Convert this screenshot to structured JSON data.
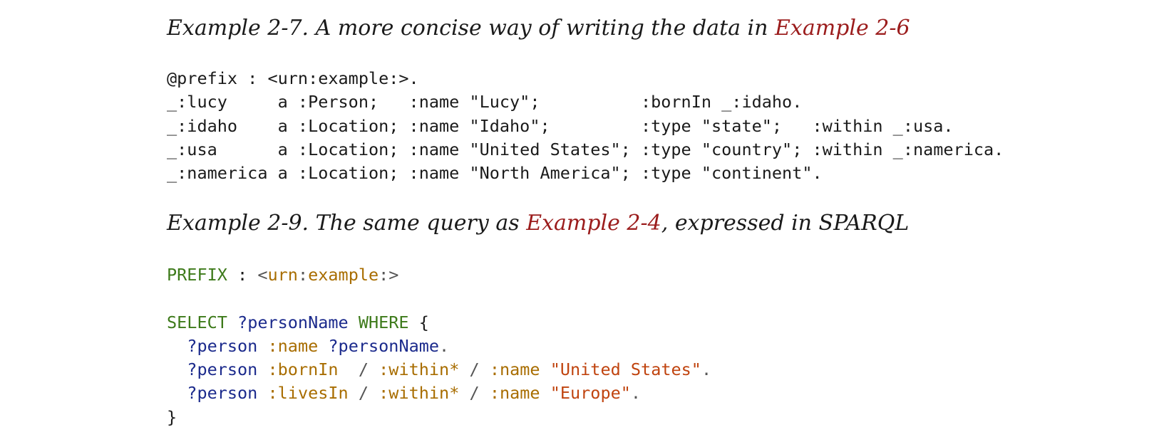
{
  "example_2_7": {
    "caption_text": "Example 2-7. A more concise way of writing the data in ",
    "caption_link": "Example 2-6",
    "code_lines": [
      "@prefix : <urn:example:>.",
      "_:lucy     a :Person;   :name \"Lucy\";          :bornIn _:idaho.",
      "_:idaho    a :Location; :name \"Idaho\";         :type \"state\";   :within _:usa.",
      "_:usa      a :Location; :name \"United States\"; :type \"country\"; :within _:namerica.",
      "_:namerica a :Location; :name \"North America\"; :type \"continent\"."
    ]
  },
  "example_2_9": {
    "caption_prefix": "Example 2-9. The same query as ",
    "caption_link": "Example 2-4",
    "caption_suffix": ", expressed in SPARQL",
    "code": {
      "prefix_kw": "PREFIX",
      "prefix_colon": " : ",
      "prefix_open": "<",
      "prefix_urn": "urn",
      "prefix_sep": ":",
      "prefix_example": "example",
      "prefix_close": ":>",
      "select_kw": "SELECT",
      "select_var": "?personName",
      "where_kw": "WHERE",
      "open_brace": "{",
      "l1_var": "?person",
      "l1_pred": ":name",
      "l1_obj": "?personName",
      "l1_end": ".",
      "l2_var": "?person",
      "l2_pred1": ":bornIn",
      "l2_slash1": "/",
      "l2_pred2": ":within*",
      "l2_slash2": "/",
      "l2_pred3": ":name",
      "l2_str": "\"United States\"",
      "l2_end": ".",
      "l3_var": "?person",
      "l3_pred1": ":livesIn",
      "l3_slash1": "/",
      "l3_pred2": ":within*",
      "l3_slash2": "/",
      "l3_pred3": ":name",
      "l3_str": "\"Europe\"",
      "l3_end": ".",
      "close_brace": "}"
    }
  }
}
